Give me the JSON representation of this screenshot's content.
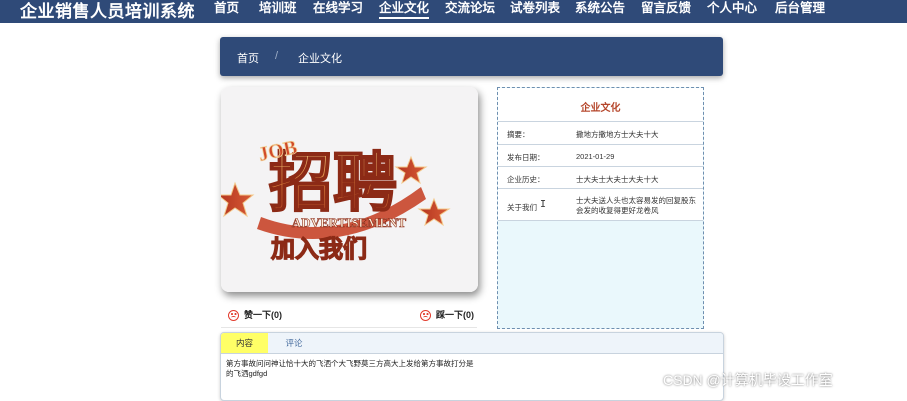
{
  "site": {
    "title": "企业销售人员培训系统"
  },
  "nav": [
    {
      "label": "首页"
    },
    {
      "label": "培训班"
    },
    {
      "label": "在线学习"
    },
    {
      "label": "企业文化"
    },
    {
      "label": "交流论坛"
    },
    {
      "label": "试卷列表"
    },
    {
      "label": "系统公告"
    },
    {
      "label": "留言反馈"
    },
    {
      "label": "个人中心"
    },
    {
      "label": "后台管理"
    }
  ],
  "nav_active": "企业文化",
  "breadcrumb": {
    "home": "首页",
    "separator": "/",
    "current": "企业文化"
  },
  "image": {
    "main_text": "招聘",
    "top_text": "JOB",
    "banner_text": "ADVERTISEMENT",
    "bottom_text": "加入我们"
  },
  "votes": {
    "like": "赞一下(0)",
    "dislike": "踩一下(0)"
  },
  "info": {
    "title": "企业文化",
    "rows": [
      {
        "label": "摘要：",
        "value": "撒地方撒地方士大夫十大"
      },
      {
        "label": "发布日期：",
        "value": "2021-01-29"
      },
      {
        "label": "企业历史：",
        "value": "士大夫士大夫士大夫十大"
      },
      {
        "label": "关于我们",
        "value": "士大夫送人头也太容易发的回复股东会发的收复得更好龙卷风"
      }
    ]
  },
  "tabs": [
    {
      "label": "内容"
    },
    {
      "label": "评论"
    }
  ],
  "content_text": "第方事故问问神让恰十大的飞洒个大飞野莫三方高大上发给第方事故打分是的飞洒gdfgd",
  "watermark": "CSDN @计算机毕设工作室",
  "colors": {
    "nav_bg": "#2f4a78",
    "accent_title": "#b5462b",
    "tab_active": "#ffff66"
  }
}
